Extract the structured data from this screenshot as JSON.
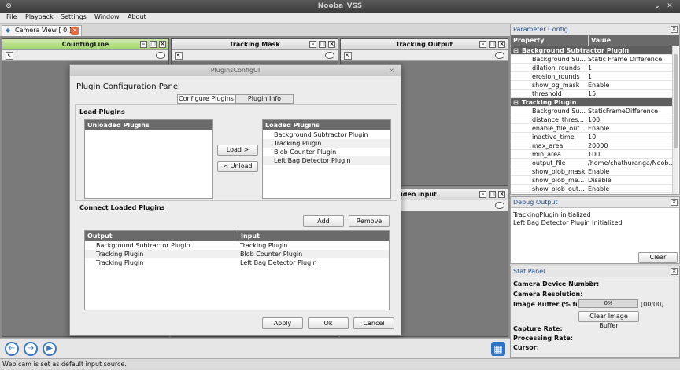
{
  "window": {
    "title": "Nooba_VSS",
    "menu": [
      "File",
      "Playback",
      "Settings",
      "Window",
      "About"
    ]
  },
  "tab": {
    "label": "Camera View [ 0 ]"
  },
  "subwindows": {
    "counting": "CountingLine",
    "mask": "Tracking Mask",
    "output": "Tracking Output",
    "video": "ideo input"
  },
  "dialog": {
    "title": "PluginsConfigUI",
    "heading": "Plugin Configuration Panel",
    "tabs": [
      "Configure Plugins",
      "Plugin Info"
    ],
    "load_section": "Load Plugins",
    "unloaded_header": "Unloaded Plugins",
    "loaded_header": "Loaded Plugins",
    "loaded_items": [
      "Background Subtractor Plugin",
      "Tracking Plugin",
      "Blob Counter Plugin",
      "Left Bag Detector Plugin"
    ],
    "load_button": "Load >",
    "unload_button": "< Unload",
    "connect_section": "Connect Loaded Plugins",
    "add_button": "Add",
    "remove_button": "Remove",
    "output_header": "Output",
    "input_header": "Input",
    "connections": [
      {
        "output": "Background Subtractor Plugin",
        "input": "Tracking Plugin"
      },
      {
        "output": "Tracking Plugin",
        "input": "Blob Counter Plugin"
      },
      {
        "output": "Tracking Plugin",
        "input": "Left Bag Detector Plugin"
      }
    ],
    "apply_button": "Apply",
    "ok_button": "Ok",
    "cancel_button": "Cancel"
  },
  "param_config": {
    "title": "Parameter Config",
    "col_property": "Property",
    "col_value": "Value",
    "groups": [
      {
        "name": "Background Subtractor Plugin",
        "rows": [
          {
            "k": "Background Su...",
            "v": "Static Frame Difference"
          },
          {
            "k": "dilation_rounds",
            "v": "1"
          },
          {
            "k": "erosion_rounds",
            "v": "1"
          },
          {
            "k": "show_bg_mask",
            "v": "Enable"
          },
          {
            "k": "threshold",
            "v": "15"
          }
        ]
      },
      {
        "name": "Tracking Plugin",
        "rows": [
          {
            "k": "Background Su...",
            "v": "StaticFrameDifference"
          },
          {
            "k": "distance_thres...",
            "v": "100"
          },
          {
            "k": "enable_file_out...",
            "v": "Enable"
          },
          {
            "k": "inactive_time",
            "v": "10"
          },
          {
            "k": "max_area",
            "v": "20000"
          },
          {
            "k": "min_area",
            "v": "100"
          },
          {
            "k": "output_file",
            "v": "/home/chathuranga/Noob..."
          },
          {
            "k": "show_blob_mask",
            "v": "Enable"
          },
          {
            "k": "show_blob_me...",
            "v": "Disable"
          },
          {
            "k": "show_blob_out...",
            "v": "Enable"
          }
        ]
      }
    ]
  },
  "debug": {
    "title": "Debug Output",
    "lines": [
      "TrackingPlugin initialized",
      "Left Bag Detector Plugin Initialized"
    ],
    "clear_button": "Clear"
  },
  "stat": {
    "title": "Stat Panel",
    "camera_device_label": "Camera Device Number:",
    "camera_device_value": "0",
    "camera_resolution_label": "Camera Resolution:",
    "image_buffer_label": "Image Buffer (% full):",
    "image_buffer_value": "0%",
    "image_buffer_fraction": 0,
    "image_buffer_count": "[00/00]",
    "clear_buffer_button": "Clear Image Buffer",
    "capture_rate_label": "Capture Rate:",
    "processing_rate_label": "Processing Rate:",
    "cursor_label": "Cursor:"
  },
  "status": "Web cam is set as default input source."
}
